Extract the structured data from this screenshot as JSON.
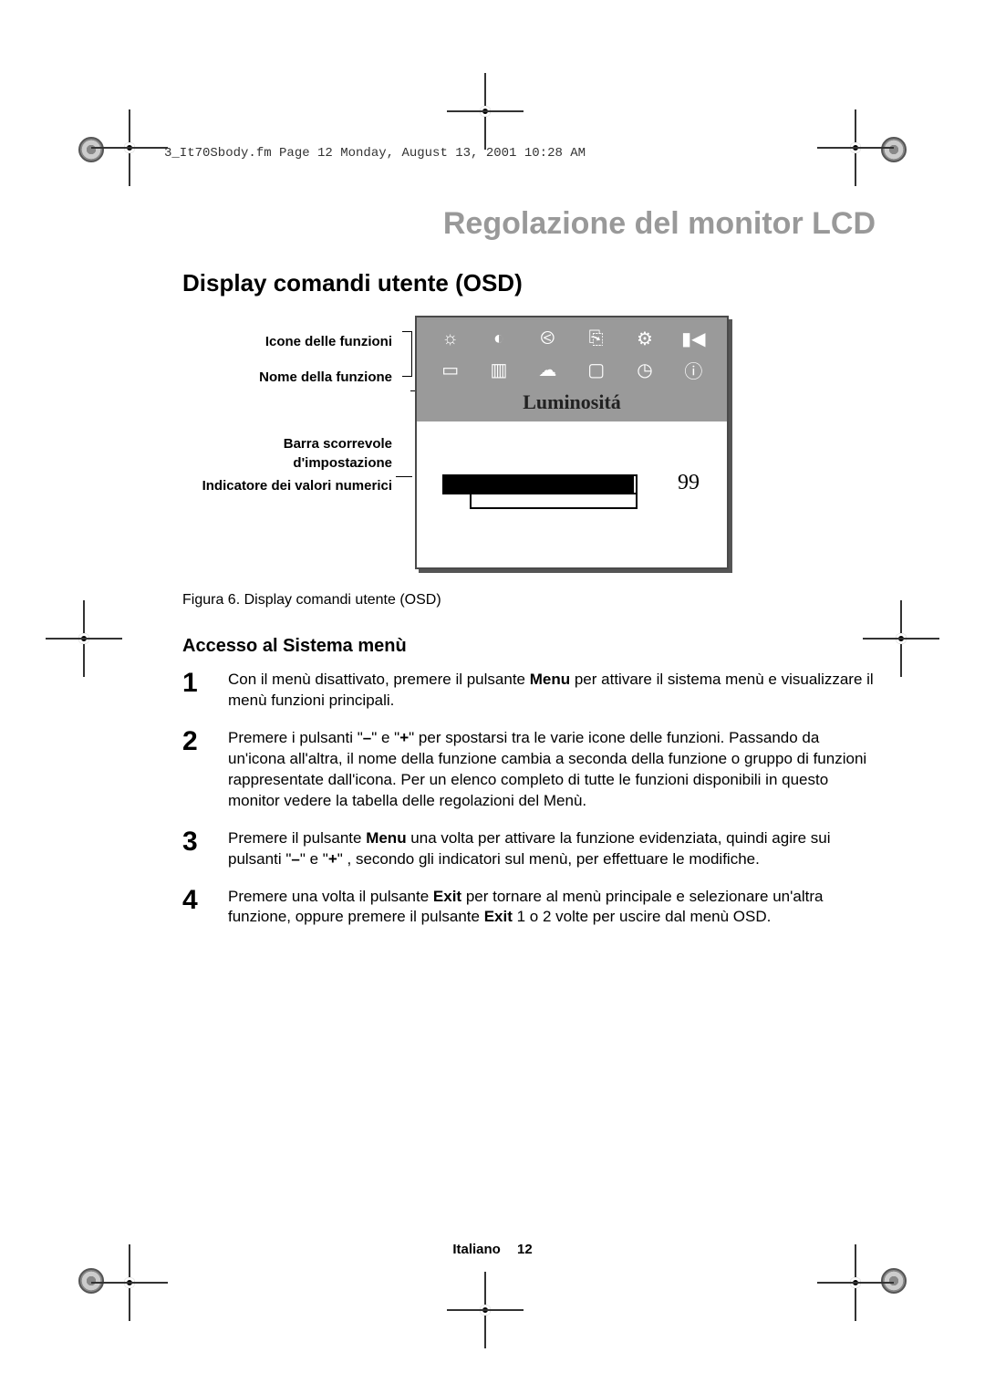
{
  "meta_line": "3_It70Sbody.fm  Page 12  Monday, August 13, 2001  10:28 AM",
  "title_grey": "Regolazione del monitor LCD",
  "section_title": "Display comandi utente (OSD)",
  "labels": {
    "icons": "Icone delle funzioni",
    "name": "Nome della funzione",
    "slider": "Barra scorrevole d'impostazione",
    "numeric": "Indicatore dei valori numerici"
  },
  "osd": {
    "function_name": "Luminositá",
    "value": "99",
    "icons_row1": [
      "brightness-icon",
      "contrast-icon",
      "hposition-icon",
      "vposition-icon",
      "color-icon",
      "zoom-icon"
    ],
    "icons_row2": [
      "autosize-icon",
      "phase-icon",
      "language-icon",
      "screen-icon",
      "clock-icon",
      "info-icon"
    ]
  },
  "caption": "Figura 6.  Display comandi utente (OSD)",
  "subheading": "Accesso al Sistema menù",
  "steps": [
    {
      "n": "1",
      "html": "Con il menù disattivato, premere il pulsante <b>Menu</b> per attivare il sistema menù e visualizzare il menù funzioni principali."
    },
    {
      "n": "2",
      "html": "Premere i pulsanti \"<b>–</b>\" e \"<b>+</b>\" per spostarsi tra le varie icone delle funzioni. Passando da un'icona all'altra, il nome della funzione cambia a seconda della funzione o gruppo di funzioni rappresentate dall'icona. Per un elenco completo di tutte le funzioni disponibili in questo monitor vedere la tabella delle regolazioni del Menù."
    },
    {
      "n": "3",
      "html": "Premere il pulsante <b>Menu</b> una volta per attivare la funzione evidenziata, quindi agire sui pulsanti  \"<b>–</b>\" e \"<b>+</b>\" , secondo gli indicatori sul menù, per effettuare le modifiche."
    },
    {
      "n": "4",
      "html": "Premere una volta il pulsante <b>Exit</b> per tornare al menù principale e selezionare un'altra funzione, oppure premere il pulsante <b>Exit</b> 1 o 2 volte per uscire dal menù OSD."
    }
  ],
  "footer": {
    "lang": "Italiano",
    "page": "12"
  },
  "icon_glyphs": {
    "brightness-icon": "☼",
    "contrast-icon": "◐",
    "hposition-icon": "⧀",
    "vposition-icon": "⎘",
    "color-icon": "⚙",
    "zoom-icon": "▮◀",
    "autosize-icon": "▭",
    "phase-icon": "▥",
    "language-icon": "☁",
    "screen-icon": "▢",
    "clock-icon": "◷",
    "info-icon": "ⓘ"
  }
}
